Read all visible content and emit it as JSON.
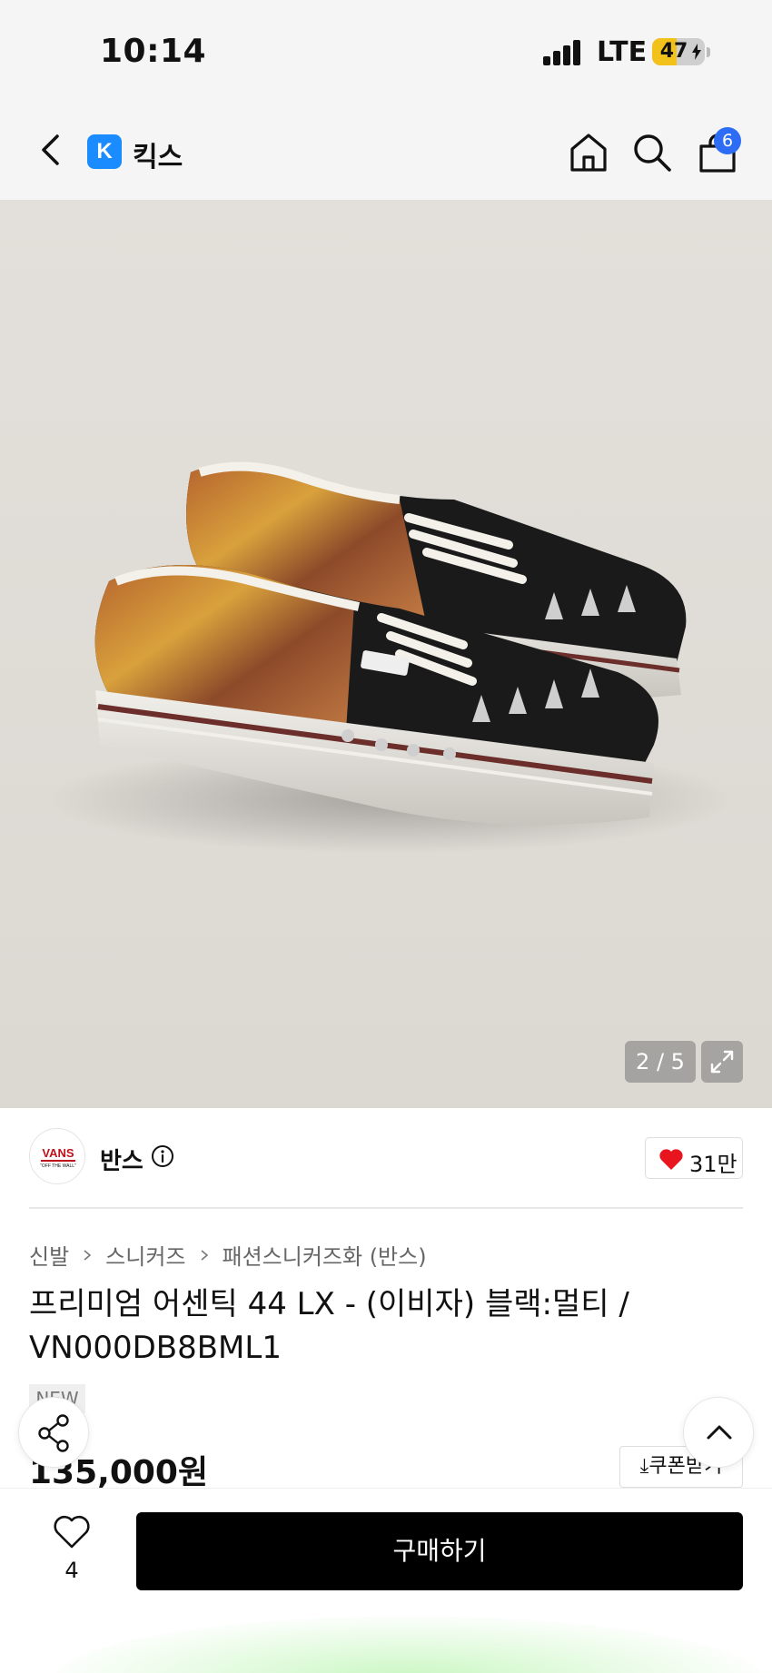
{
  "status_bar": {
    "time": "10:14",
    "network": "LTE",
    "battery_level": "47",
    "battery_percent": 47
  },
  "nav": {
    "brand_logo_letter": "K",
    "brand_name": "킥스",
    "cart_count": "6",
    "icons": [
      "chevron-left-icon",
      "home-icon",
      "search-icon",
      "shopping-bag-icon"
    ]
  },
  "hero": {
    "counter": "2 / 5"
  },
  "brand": {
    "logo_text": "VANS",
    "logo_subtext": "\"OFF THE WALL\"",
    "name": "반스",
    "likes": "31만"
  },
  "breadcrumb": [
    "신발",
    "스니커즈",
    "패션스니커즈화 (반스)"
  ],
  "product": {
    "title": "프리미엄 어센틱 44 LX - (이비자) 블랙:멀티 / VN000DB8BML1",
    "badge": "NEW",
    "price": "135,000원",
    "coupon_label": "쿠폰받기"
  },
  "bottom": {
    "wish_count": "4",
    "buy_label": "구매하기"
  },
  "colors": {
    "accent_blue": "#1a8cff",
    "badge_blue": "#2d6df6",
    "heart_red": "#e8141e",
    "buy_button": "#000000",
    "battery_yellow": "#f2c21a"
  }
}
